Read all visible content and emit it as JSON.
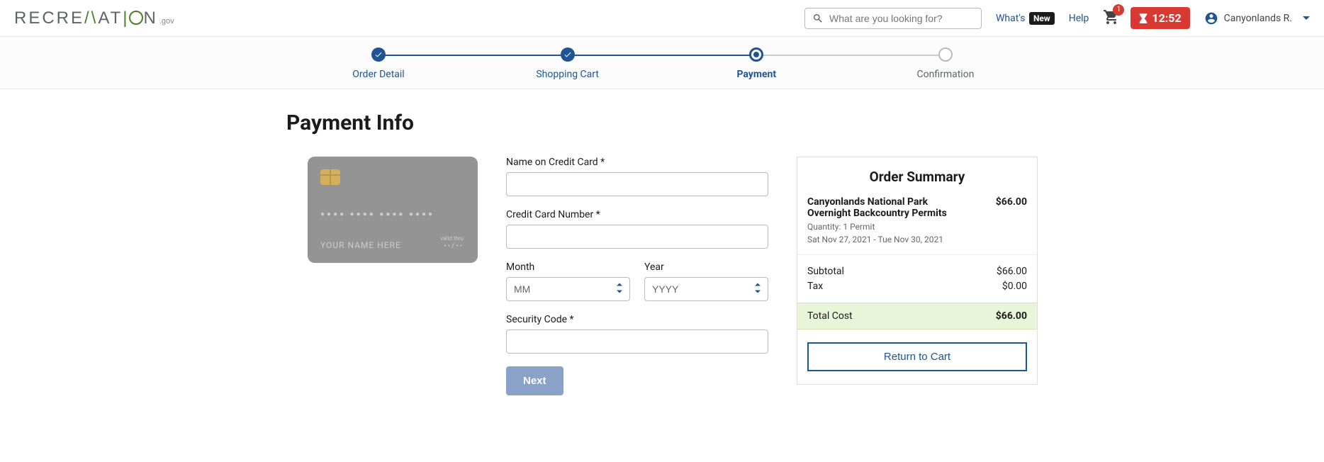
{
  "header": {
    "logo_text_1": "RECRE",
    "logo_text_2": "AT",
    "logo_text_3": "N",
    "logo_suffix": ".gov",
    "search_placeholder": "What are you looking for?",
    "whats": "What's",
    "new_badge": "New",
    "help": "Help",
    "cart_count": "1",
    "timer": "12:52",
    "account_name": "Canyonlands R."
  },
  "progress": {
    "step1": "Order Detail",
    "step2": "Shopping Cart",
    "step3": "Payment",
    "step4": "Confirmation"
  },
  "page_title": "Payment Info",
  "card": {
    "dots": "●●●●  ●●●●  ●●●●  ●●●●",
    "name": "YOUR NAME HERE",
    "valid": "valid thru",
    "exp": "••/••"
  },
  "form": {
    "name_label": "Name on Credit Card *",
    "number_label": "Credit Card Number *",
    "month_label": "Month",
    "month_placeholder": "MM",
    "year_label": "Year",
    "year_placeholder": "YYYY",
    "code_label": "Security Code *",
    "next_btn": "Next"
  },
  "summary": {
    "title": "Order Summary",
    "item_name": "Canyonlands National Park Overnight Backcountry Permits",
    "item_price": "$66.00",
    "quantity": "Quantity: 1 Permit",
    "dates": "Sat Nov 27, 2021 - Tue Nov 30, 2021",
    "subtotal_label": "Subtotal",
    "subtotal_val": "$66.00",
    "tax_label": "Tax",
    "tax_val": "$0.00",
    "total_label": "Total Cost",
    "total_val": "$66.00",
    "return_btn": "Return to Cart"
  }
}
